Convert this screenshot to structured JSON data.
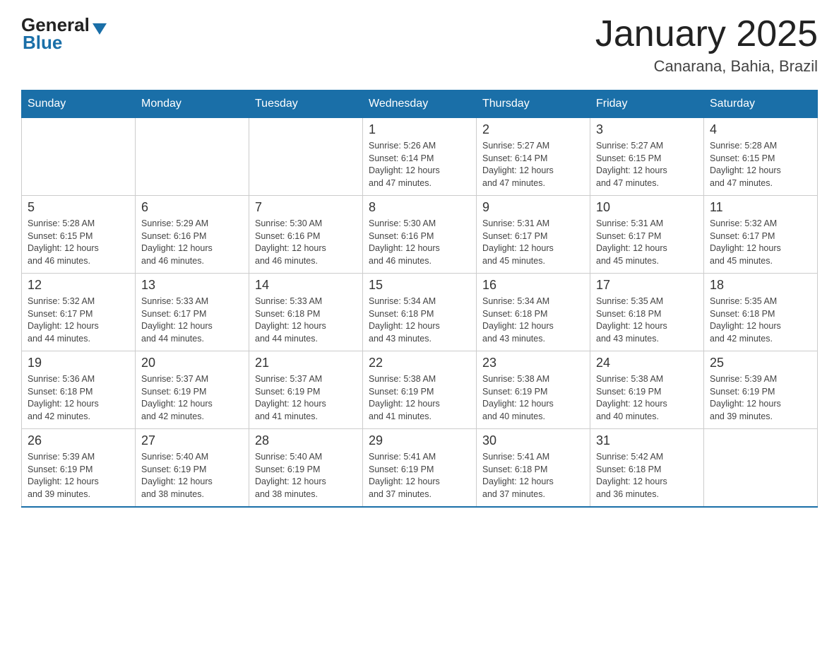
{
  "header": {
    "logo_text1": "General",
    "logo_text2": "Blue",
    "title": "January 2025",
    "subtitle": "Canarana, Bahia, Brazil"
  },
  "weekdays": [
    "Sunday",
    "Monday",
    "Tuesday",
    "Wednesday",
    "Thursday",
    "Friday",
    "Saturday"
  ],
  "weeks": [
    [
      {
        "day": "",
        "info": ""
      },
      {
        "day": "",
        "info": ""
      },
      {
        "day": "",
        "info": ""
      },
      {
        "day": "1",
        "info": "Sunrise: 5:26 AM\nSunset: 6:14 PM\nDaylight: 12 hours\nand 47 minutes."
      },
      {
        "day": "2",
        "info": "Sunrise: 5:27 AM\nSunset: 6:14 PM\nDaylight: 12 hours\nand 47 minutes."
      },
      {
        "day": "3",
        "info": "Sunrise: 5:27 AM\nSunset: 6:15 PM\nDaylight: 12 hours\nand 47 minutes."
      },
      {
        "day": "4",
        "info": "Sunrise: 5:28 AM\nSunset: 6:15 PM\nDaylight: 12 hours\nand 47 minutes."
      }
    ],
    [
      {
        "day": "5",
        "info": "Sunrise: 5:28 AM\nSunset: 6:15 PM\nDaylight: 12 hours\nand 46 minutes."
      },
      {
        "day": "6",
        "info": "Sunrise: 5:29 AM\nSunset: 6:16 PM\nDaylight: 12 hours\nand 46 minutes."
      },
      {
        "day": "7",
        "info": "Sunrise: 5:30 AM\nSunset: 6:16 PM\nDaylight: 12 hours\nand 46 minutes."
      },
      {
        "day": "8",
        "info": "Sunrise: 5:30 AM\nSunset: 6:16 PM\nDaylight: 12 hours\nand 46 minutes."
      },
      {
        "day": "9",
        "info": "Sunrise: 5:31 AM\nSunset: 6:17 PM\nDaylight: 12 hours\nand 45 minutes."
      },
      {
        "day": "10",
        "info": "Sunrise: 5:31 AM\nSunset: 6:17 PM\nDaylight: 12 hours\nand 45 minutes."
      },
      {
        "day": "11",
        "info": "Sunrise: 5:32 AM\nSunset: 6:17 PM\nDaylight: 12 hours\nand 45 minutes."
      }
    ],
    [
      {
        "day": "12",
        "info": "Sunrise: 5:32 AM\nSunset: 6:17 PM\nDaylight: 12 hours\nand 44 minutes."
      },
      {
        "day": "13",
        "info": "Sunrise: 5:33 AM\nSunset: 6:17 PM\nDaylight: 12 hours\nand 44 minutes."
      },
      {
        "day": "14",
        "info": "Sunrise: 5:33 AM\nSunset: 6:18 PM\nDaylight: 12 hours\nand 44 minutes."
      },
      {
        "day": "15",
        "info": "Sunrise: 5:34 AM\nSunset: 6:18 PM\nDaylight: 12 hours\nand 43 minutes."
      },
      {
        "day": "16",
        "info": "Sunrise: 5:34 AM\nSunset: 6:18 PM\nDaylight: 12 hours\nand 43 minutes."
      },
      {
        "day": "17",
        "info": "Sunrise: 5:35 AM\nSunset: 6:18 PM\nDaylight: 12 hours\nand 43 minutes."
      },
      {
        "day": "18",
        "info": "Sunrise: 5:35 AM\nSunset: 6:18 PM\nDaylight: 12 hours\nand 42 minutes."
      }
    ],
    [
      {
        "day": "19",
        "info": "Sunrise: 5:36 AM\nSunset: 6:18 PM\nDaylight: 12 hours\nand 42 minutes."
      },
      {
        "day": "20",
        "info": "Sunrise: 5:37 AM\nSunset: 6:19 PM\nDaylight: 12 hours\nand 42 minutes."
      },
      {
        "day": "21",
        "info": "Sunrise: 5:37 AM\nSunset: 6:19 PM\nDaylight: 12 hours\nand 41 minutes."
      },
      {
        "day": "22",
        "info": "Sunrise: 5:38 AM\nSunset: 6:19 PM\nDaylight: 12 hours\nand 41 minutes."
      },
      {
        "day": "23",
        "info": "Sunrise: 5:38 AM\nSunset: 6:19 PM\nDaylight: 12 hours\nand 40 minutes."
      },
      {
        "day": "24",
        "info": "Sunrise: 5:38 AM\nSunset: 6:19 PM\nDaylight: 12 hours\nand 40 minutes."
      },
      {
        "day": "25",
        "info": "Sunrise: 5:39 AM\nSunset: 6:19 PM\nDaylight: 12 hours\nand 39 minutes."
      }
    ],
    [
      {
        "day": "26",
        "info": "Sunrise: 5:39 AM\nSunset: 6:19 PM\nDaylight: 12 hours\nand 39 minutes."
      },
      {
        "day": "27",
        "info": "Sunrise: 5:40 AM\nSunset: 6:19 PM\nDaylight: 12 hours\nand 38 minutes."
      },
      {
        "day": "28",
        "info": "Sunrise: 5:40 AM\nSunset: 6:19 PM\nDaylight: 12 hours\nand 38 minutes."
      },
      {
        "day": "29",
        "info": "Sunrise: 5:41 AM\nSunset: 6:19 PM\nDaylight: 12 hours\nand 37 minutes."
      },
      {
        "day": "30",
        "info": "Sunrise: 5:41 AM\nSunset: 6:18 PM\nDaylight: 12 hours\nand 37 minutes."
      },
      {
        "day": "31",
        "info": "Sunrise: 5:42 AM\nSunset: 6:18 PM\nDaylight: 12 hours\nand 36 minutes."
      },
      {
        "day": "",
        "info": ""
      }
    ]
  ]
}
